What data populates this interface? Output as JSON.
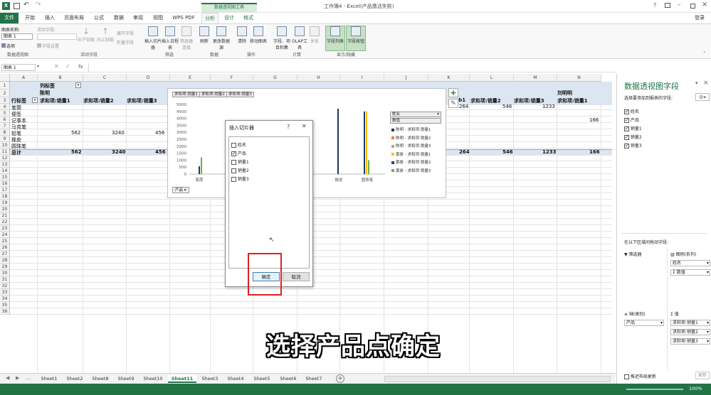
{
  "titlebar": {
    "title": "工作簿4 - Excel(产品激活失败)",
    "signin": "登录"
  },
  "pivot_tools_label": "数据透视图工具",
  "tabs": [
    "文件",
    "开始",
    "插入",
    "页面布局",
    "公式",
    "数据",
    "审阅",
    "视图",
    "WPS PDF",
    "分析",
    "设计",
    "格式"
  ],
  "ribbon": {
    "chart_name_label": "图表名称:",
    "chart_name_value": "图表 1",
    "options": "选项",
    "pivot_group": "数据透视图",
    "active_field_label": "活动字段:",
    "field_settings": "字段设置",
    "drill_down": "向下钻取",
    "drill_up": "向上钻取",
    "expand_field": "展开字段",
    "collapse_field": "折叠字段",
    "active_field_group": "活动字段",
    "insert_slicer": "插入切片器",
    "insert_timeline": "插入日程表",
    "filter_connections": "筛选器连接",
    "filter_group": "筛选",
    "refresh": "刷新",
    "change_source": "更改数据源",
    "data_group": "数据",
    "clear": "清除",
    "move_chart": "移动图表",
    "actions_group": "操作",
    "fields_items": "字段、项目和集",
    "olap": "OLAP工具",
    "relations": "关系",
    "calc_group": "计算",
    "field_list": "字段列表",
    "field_buttons": "字段按钮",
    "show_group": "显示/隐藏"
  },
  "formula_bar": {
    "name_box": "图表 1",
    "fx": "fx"
  },
  "columns": [
    "A",
    "B",
    "C",
    "D",
    "E",
    "F",
    "G",
    "H",
    "I",
    "J",
    "K",
    "L",
    "M",
    "N"
  ],
  "rows": [
    "1",
    "2",
    "3",
    "4",
    "5",
    "6",
    "7",
    "8",
    "9",
    "10",
    "11",
    "12",
    "13",
    "14",
    "15",
    "16",
    "17",
    "18",
    "19",
    "20",
    "21",
    "22",
    "23",
    "24",
    "25",
    "26",
    "27",
    "28",
    "29",
    "30",
    "31",
    "32",
    "33",
    "34",
    "35",
    "36"
  ],
  "pivot": {
    "col_label_header": "列标签",
    "person1": "陈明",
    "row_label_header": "行标签",
    "sum_headers": [
      "求和项:销量1",
      "求和项:销量2",
      "求和项:销量3"
    ],
    "right_sum_headers": [
      "求和项:销量2",
      "求和项:销量3",
      "求和项:销量1"
    ],
    "person_right": "刘明明",
    "rows": [
      "笔筒",
      "便签",
      "记事本",
      "马克笔",
      "铅笔",
      "橡皮",
      "圆珠笔"
    ],
    "pencil_values": [
      "562",
      "3240",
      "456"
    ],
    "total_label": "总计",
    "total_values": [
      "562",
      "3240",
      "456"
    ],
    "right_col1_val": "264",
    "right_col1_partial": "umb1",
    "right_vals_row5": [
      "264",
      "546",
      "1233"
    ],
    "right_val_row7": "166",
    "total_right": [
      "264",
      "546",
      "1233",
      "166"
    ]
  },
  "chart": {
    "field_buttons": [
      "求和项:销量1",
      "求和项:销量2",
      "求和项:销量3"
    ],
    "y_ticks": [
      "5000",
      "4500",
      "4000",
      "3500",
      "3000",
      "2500",
      "2000",
      "1500",
      "1000",
      "500",
      "0"
    ],
    "x_labels": [
      "笔筒",
      "便",
      "",
      "",
      "",
      "橡皮",
      "圆珠笔"
    ],
    "axis_button": "产品",
    "legend_dropdown_1": "姓名",
    "legend_dropdown_2": "数值",
    "legend_items": [
      "陈明 - 求和项:销量1",
      "陈明 - 求和项:销量2",
      "陈明 - 求和项:销量3",
      "黄俊 - 求和项:销量1",
      "黄俊 - 求和项:销量2",
      "黄俊 - 求和项:销量3"
    ],
    "legend_colors": [
      "#1f3864",
      "#ed7d31",
      "#a5a5a5",
      "#ffc000",
      "#264478",
      "#70ad47"
    ]
  },
  "dialog": {
    "title": "插入切片器",
    "help": "?",
    "close": "✕",
    "fields": [
      {
        "label": "姓名",
        "checked": false
      },
      {
        "label": "产品",
        "checked": true
      },
      {
        "label": "销量1",
        "checked": false
      },
      {
        "label": "销量2",
        "checked": false
      },
      {
        "label": "销量3",
        "checked": false
      }
    ],
    "ok": "确定",
    "cancel": "取消"
  },
  "pane": {
    "title": "数据透视图字段",
    "subtitle": "选择要添加到报表的字段:",
    "fields": [
      {
        "label": "姓名",
        "checked": true
      },
      {
        "label": "产品",
        "checked": true
      },
      {
        "label": "销量1",
        "checked": true
      },
      {
        "label": "销量2",
        "checked": true
      },
      {
        "label": "销量3",
        "checked": true
      }
    ],
    "drag_hint": "在以下区域间拖动字段:",
    "filters": "筛选器",
    "legend_series": "图例(系列)",
    "legend_values": [
      "姓名",
      "Σ 数值"
    ],
    "axis": "轴(类别)",
    "values": "Σ 值",
    "axis_values": [
      "产品"
    ],
    "value_items": [
      "求和项:销量1",
      "求和项:销量2",
      "求和项:销量3"
    ],
    "defer": "推迟布局更新",
    "update": "更新"
  },
  "sheets": [
    "Sheet1",
    "Sheet2",
    "Sheet8",
    "Sheet9",
    "Sheet10",
    "Sheet11",
    "Sheet3",
    "Sheet4",
    "Sheet5",
    "Sheet6",
    "Sheet7"
  ],
  "active_sheet": "Sheet11",
  "status": {
    "zoom": "100%"
  },
  "caption": "选择产品点确定"
}
